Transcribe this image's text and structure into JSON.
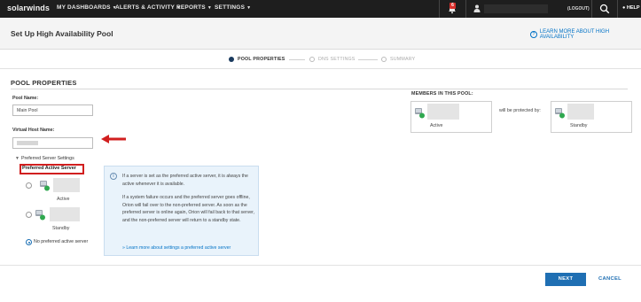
{
  "brand": {
    "name": "solarwinds",
    "accent": "#f58220"
  },
  "topnav": {
    "items": [
      {
        "label": "MY DASHBOARDS"
      },
      {
        "label": "ALERTS & ACTIVITY"
      },
      {
        "label": "REPORTS"
      },
      {
        "label": "SETTINGS"
      }
    ],
    "notification_count": "6",
    "logout_label": "(LOGOUT)",
    "help_label": "HELP",
    "icons": [
      "bell-icon",
      "user-icon",
      "search-icon",
      "help-icon"
    ]
  },
  "header": {
    "title": "Set Up High Availability Pool",
    "learn_more": "LEARN MORE ABOUT HIGH AVAILABILITY"
  },
  "wizard": {
    "steps": [
      {
        "label": "POOL PROPERTIES",
        "state": "active"
      },
      {
        "label": "DNS SETTINGS",
        "state": "inactive"
      },
      {
        "label": "SUMMARY",
        "state": "inactive"
      }
    ]
  },
  "pool_properties": {
    "section_title": "POOL PROPERTIES",
    "pool_name_label": "Pool Name:",
    "pool_name_value": "Main Pool",
    "virtual_host_label": "Virtual Host Name:",
    "preferred_settings_label": "Preferred Server Settings",
    "preferred_active_label": "Preferred Active Server",
    "options": [
      {
        "state_label": "Active",
        "selected": false
      },
      {
        "state_label": "Standby",
        "selected": false
      },
      {
        "label": "No preferred active server",
        "selected": true
      }
    ]
  },
  "info": {
    "p1": "If a server is set as the preferred active server, it is always the active whenever it is available.",
    "p2": "If a system failure occurs and the preferred server goes offline, Orion will fail over to the non-preferred server. As soon as the preferred server is online again, Orion will fail back to that server, and the non-preferred server will return to a standby state.",
    "link": "» Learn more about settings a preferred active server"
  },
  "members": {
    "label": "MEMBERS IN THIS POOL:",
    "protected_by": "will be protected by:",
    "servers": [
      {
        "state": "Active"
      },
      {
        "state": "Standby"
      }
    ]
  },
  "footer": {
    "next": "NEXT",
    "cancel": "CANCEL"
  },
  "colors": {
    "nav_bg": "#1e1e1e",
    "primary": "#1f6fb3",
    "highlight_red": "#d11f1f",
    "status_green": "#2fa84f",
    "info_bg": "#e9f3fb"
  }
}
